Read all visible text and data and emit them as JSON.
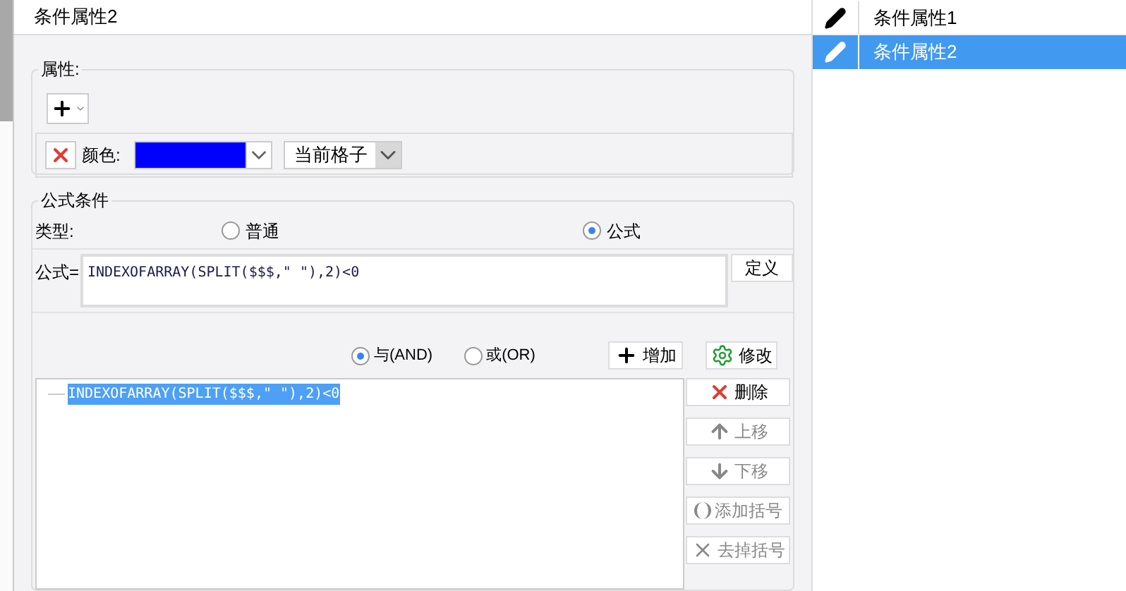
{
  "title": "条件属性2",
  "attributes": {
    "legend": "属性:",
    "rows": [
      {
        "label": "颜色:",
        "color": "#0000ff",
        "scope": "当前格子"
      }
    ]
  },
  "formula_condition": {
    "legend": "公式条件",
    "type_label": "类型:",
    "types": [
      {
        "label": "普通",
        "selected": false
      },
      {
        "label": "公式",
        "selected": true
      }
    ],
    "formula_label": "公式=",
    "formula": "INDEXOFARRAY(SPLIT($$$,\" \"),2)<0",
    "define_button": "定义",
    "logic": [
      {
        "label": "与(AND)",
        "selected": true
      },
      {
        "label": "或(OR)",
        "selected": false
      }
    ],
    "add": "增加",
    "modify": "修改",
    "conditions": [
      {
        "text": "INDEXOFARRAY(SPLIT($$$,\" \"),2)<0",
        "selected": true
      }
    ],
    "actions": [
      {
        "kind": "delete",
        "label": "删除",
        "disabled": false
      },
      {
        "kind": "up",
        "label": "上移",
        "disabled": true
      },
      {
        "kind": "down",
        "label": "下移",
        "disabled": true
      },
      {
        "kind": "addparen",
        "label": "添加括号",
        "disabled": true
      },
      {
        "kind": "removeparen",
        "label": "去掉括号",
        "disabled": true
      }
    ]
  },
  "list": [
    {
      "label": "条件属性1",
      "selected": false
    },
    {
      "label": "条件属性2",
      "selected": true
    }
  ]
}
